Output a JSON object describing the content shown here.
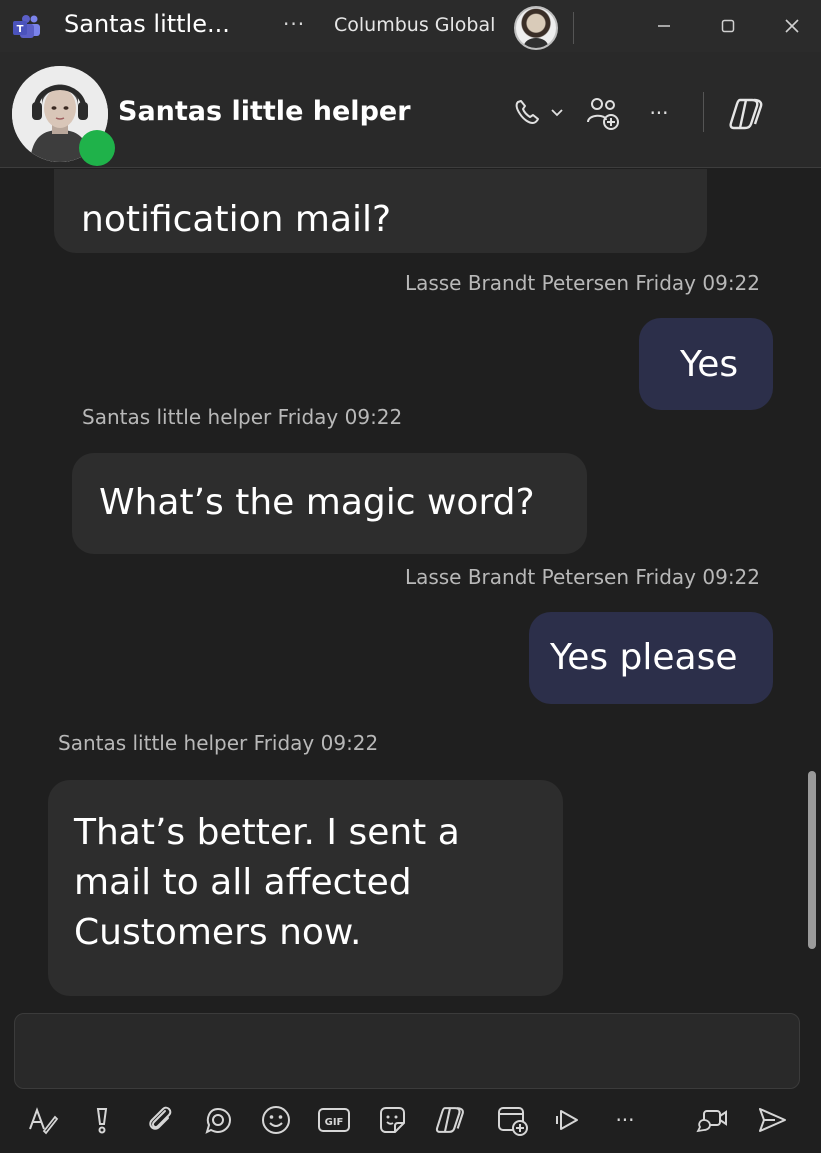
{
  "window": {
    "title": "Santas little...",
    "more_label": "···",
    "org_name": "Columbus Global"
  },
  "chat": {
    "name": "Santas little helper",
    "more_label": "···"
  },
  "messages": [
    {
      "id": "m1",
      "direction": "in",
      "text": "notification mail?"
    },
    {
      "id": "m2",
      "direction": "out",
      "sender": "Lasse Brandt Petersen",
      "time": "Friday 09:22",
      "text": "Yes"
    },
    {
      "id": "m3",
      "direction": "in",
      "sender": "Santas little helper",
      "time": "Friday 09:22",
      "text": "What’s the magic word?"
    },
    {
      "id": "m4",
      "direction": "out",
      "sender": "Lasse Brandt Petersen",
      "time": "Friday 09:22",
      "text": "Yes please"
    },
    {
      "id": "m5",
      "direction": "in",
      "sender": "Santas little helper",
      "time": "Friday 09:22",
      "text": "That’s better. I sent a mail to all affected Customers now."
    }
  ],
  "compose": {
    "value": "",
    "placeholder": ""
  },
  "toolbar": {
    "gif_label": "GIF",
    "more_label": "···",
    "icons": [
      "format-icon",
      "priority-icon",
      "attach-icon",
      "loop-icon",
      "emoji-icon",
      "gif-icon",
      "sticker-icon",
      "copilot-icon",
      "schedule-meeting-icon",
      "stream-icon",
      "more-icon",
      "meet-now-icon",
      "send-icon"
    ]
  },
  "colors": {
    "background": "#1f1f1f",
    "incoming_bubble": "#2d2d2d",
    "outgoing_bubble": "#2c2f4a",
    "presence_available": "#1fb24a",
    "teams_purple": "#5b5fc7"
  }
}
